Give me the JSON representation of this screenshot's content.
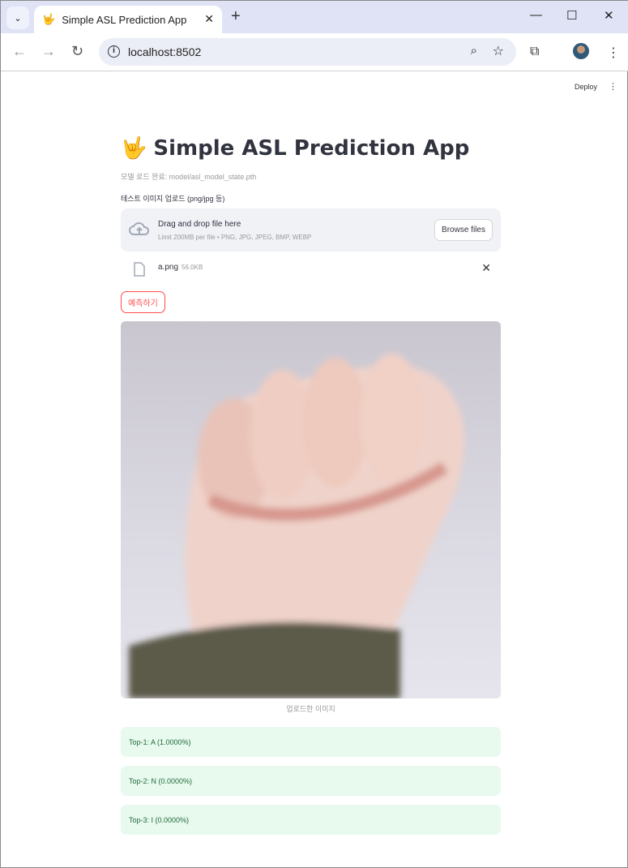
{
  "browser": {
    "tab_title": "Simple ASL Prediction App",
    "url": "localhost:8502"
  },
  "header": {
    "deploy_label": "Deploy"
  },
  "main": {
    "title_icon": "🤟",
    "title": "Simple ASL Prediction App",
    "model_caption": "모델 로드 완료: model/asl_model_state.pth",
    "uploader_label": "테스트 이미지 업로드 (png/jpg 등)",
    "drop_title": "Drag and drop file here",
    "drop_limit": "Limit 200MB per file • PNG, JPG, JPEG, BMP, WEBP",
    "browse_label": "Browse files",
    "file_name": "a.png",
    "file_size": "56.0KB",
    "predict_label": "예측하기",
    "image_caption": "업로드한 이미지",
    "results": [
      "Top-1: A (1.0000%)",
      "Top-2: N (0.0000%)",
      "Top-3: I (0.0000%)"
    ]
  },
  "colors": {
    "accent": "#ff4b4b",
    "success_bg": "#e8f9ee"
  }
}
